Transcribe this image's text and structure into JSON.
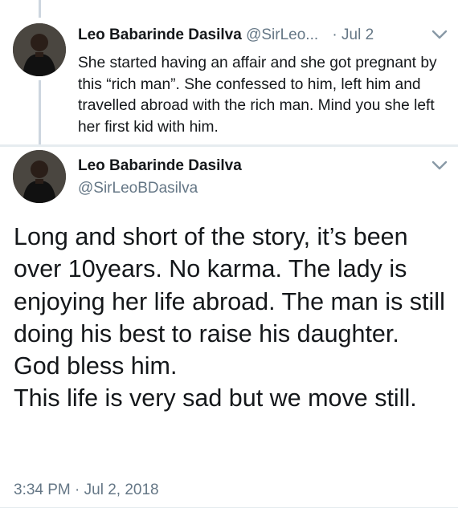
{
  "reply_tweet": {
    "display_name": "Leo Babarinde Dasilva",
    "handle": "@SirLeo...",
    "separator": "·",
    "date": "Jul 2",
    "text": "She started having an affair and she got pregnant by this “rich man”. She confessed to him, left him and travelled abroad with the rich man. Mind you she left her first kid with him."
  },
  "main_tweet": {
    "display_name": "Leo Babarinde Dasilva",
    "handle": "@SirLeoBDasilva",
    "text": "Long and short of the story, it’s been over 10years. No karma. The lady is enjoying her life abroad. The man is still doing his best to raise his daughter. God bless him.\nThis life is very sad but we move still.",
    "timestamp": "3:34 PM · Jul 2, 2018"
  },
  "icons": {
    "menu": "chevron-down-icon",
    "avatar": "profile-photo"
  },
  "colors": {
    "text": "#14171a",
    "secondary": "#657786",
    "thread_line": "#cdd6df",
    "divider": "#e6ecf0"
  }
}
